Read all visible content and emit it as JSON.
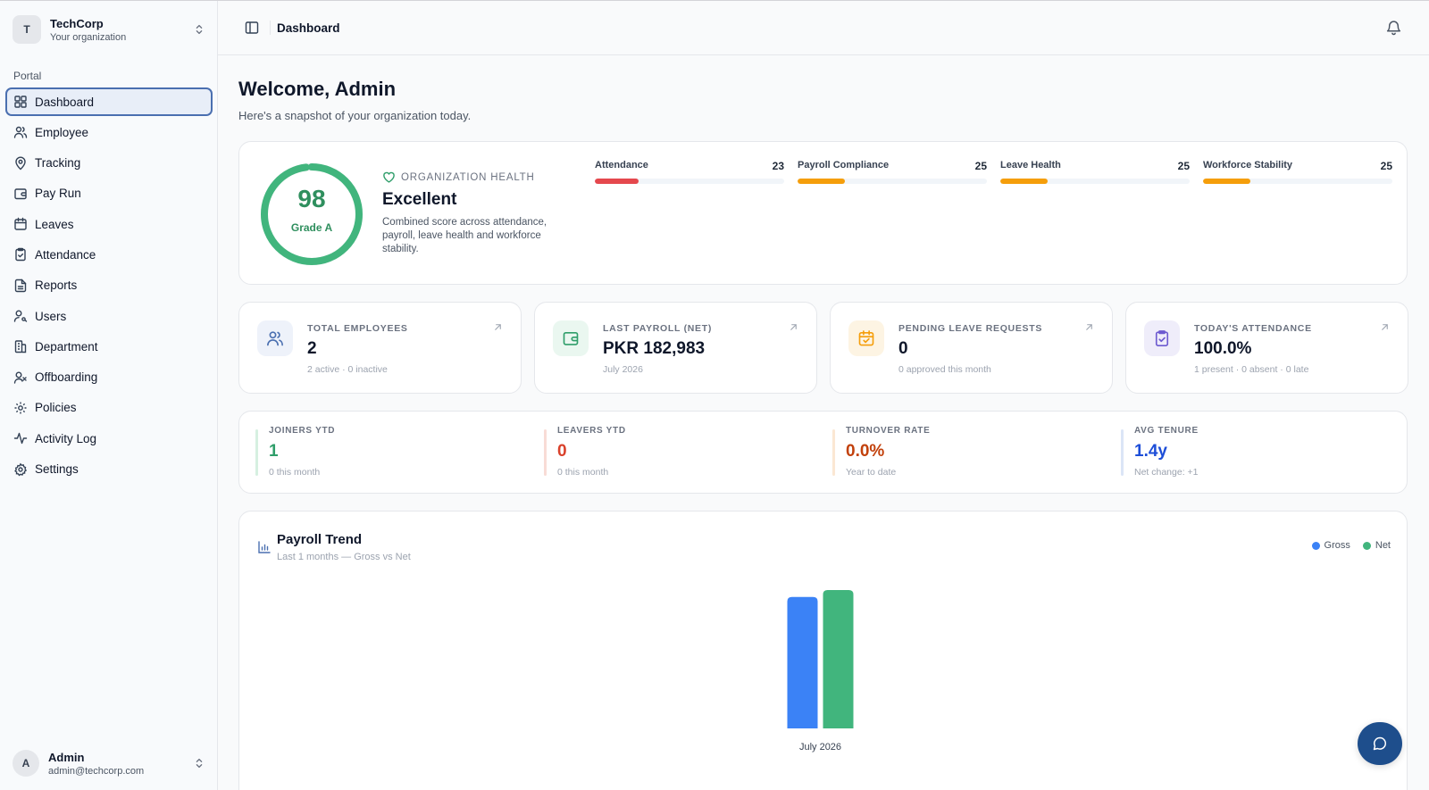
{
  "org": {
    "initial": "T",
    "name": "TechCorp",
    "subtitle": "Your organization"
  },
  "sidebar": {
    "section_label": "Portal",
    "items": [
      {
        "label": "Dashboard",
        "icon": "grid-icon",
        "active": true
      },
      {
        "label": "Employee",
        "icon": "users-icon"
      },
      {
        "label": "Tracking",
        "icon": "map-pin-icon"
      },
      {
        "label": "Pay Run",
        "icon": "wallet-icon"
      },
      {
        "label": "Leaves",
        "icon": "calendar-icon"
      },
      {
        "label": "Attendance",
        "icon": "clipboard-check-icon"
      },
      {
        "label": "Reports",
        "icon": "file-text-icon"
      },
      {
        "label": "Users",
        "icon": "user-key-icon"
      },
      {
        "label": "Department",
        "icon": "building-icon"
      },
      {
        "label": "Offboarding",
        "icon": "user-x-icon"
      },
      {
        "label": "Policies",
        "icon": "cog-icon"
      },
      {
        "label": "Activity Log",
        "icon": "activity-icon"
      },
      {
        "label": "Settings",
        "icon": "settings-icon"
      }
    ]
  },
  "user": {
    "initial": "A",
    "name": "Admin",
    "email": "admin@techcorp.com"
  },
  "header": {
    "title": "Dashboard"
  },
  "welcome": {
    "title": "Welcome, Admin",
    "subtitle": "Here's a snapshot of your organization today."
  },
  "health": {
    "score": "98",
    "score_value": 98,
    "grade": "Grade A",
    "label": "ORGANIZATION HEALTH",
    "status": "Excellent",
    "description": "Combined score across attendance, payroll, leave health and workforce stability.",
    "metrics": [
      {
        "name": "Attendance",
        "value": "23",
        "fraction": 0.23,
        "color": "#e5484d"
      },
      {
        "name": "Payroll Compliance",
        "value": "25",
        "fraction": 0.25,
        "color": "#f59e0b"
      },
      {
        "name": "Leave Health",
        "value": "25",
        "fraction": 0.25,
        "color": "#f59e0b"
      },
      {
        "name": "Workforce Stability",
        "value": "25",
        "fraction": 0.25,
        "color": "#f59e0b"
      }
    ]
  },
  "stats": [
    {
      "label": "TOTAL EMPLOYEES",
      "value": "2",
      "sub": "2 active · 0 inactive",
      "icon": "users-icon",
      "color": "#4a6fb0"
    },
    {
      "label": "LAST PAYROLL (NET)",
      "value": "PKR 182,983",
      "sub": "July 2026",
      "icon": "wallet-icon",
      "color": "#2f9e6a"
    },
    {
      "label": "PENDING LEAVE REQUESTS",
      "value": "0",
      "sub": "0 approved this month",
      "icon": "calendar-check-icon",
      "color": "#f59e0b"
    },
    {
      "label": "TODAY'S ATTENDANCE",
      "value": "100.0%",
      "sub": "1 present · 0 absent · 0 late",
      "icon": "clipboard-check-icon",
      "color": "#6d5bd0"
    }
  ],
  "kpis": [
    {
      "label": "JOINERS YTD",
      "value": "1",
      "sub": "0 this month",
      "color": "#2f9e6a"
    },
    {
      "label": "LEAVERS YTD",
      "value": "0",
      "sub": "0 this month",
      "color": "#d9412b"
    },
    {
      "label": "TURNOVER RATE",
      "value": "0.0%",
      "sub": "Year to date",
      "color": "#c2410c"
    },
    {
      "label": "AVG TENURE",
      "value": "1.4y",
      "sub": "Net change: +1",
      "color": "#1d4ed8"
    }
  ],
  "trend": {
    "title": "Payroll Trend",
    "subtitle": "Last 1 months — Gross vs Net",
    "legend": [
      {
        "name": "Gross",
        "color": "#3b82f6"
      },
      {
        "name": "Net",
        "color": "#41b57d"
      }
    ]
  },
  "chart_data": {
    "type": "bar",
    "categories": [
      "July 2026"
    ],
    "series": [
      {
        "name": "Gross",
        "values": [
          0.95
        ],
        "color": "#3b82f6"
      },
      {
        "name": "Net",
        "values": [
          1.0
        ],
        "color": "#41b57d"
      }
    ],
    "title": "Payroll Trend",
    "xlabel": "",
    "ylabel": "",
    "ylim": [
      0,
      1
    ]
  }
}
